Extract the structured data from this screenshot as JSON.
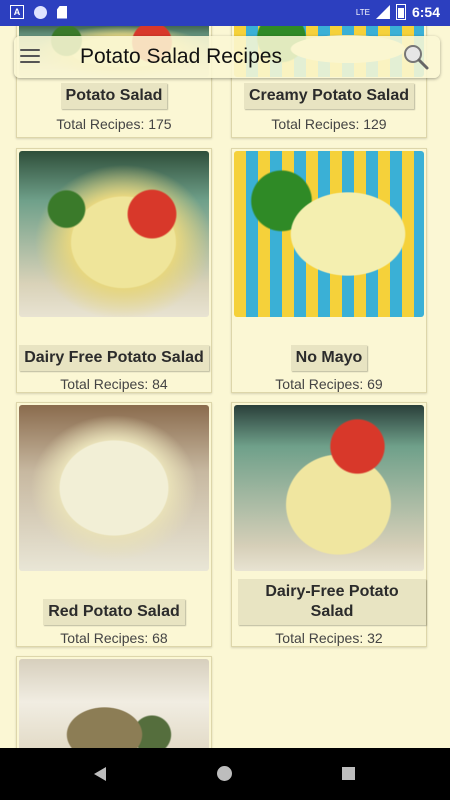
{
  "status_bar": {
    "time": "6:54",
    "network": "LTE"
  },
  "app_bar": {
    "title": "Potato Salad Recipes",
    "menu_icon": "hamburger-menu-icon",
    "search_icon": "search-icon"
  },
  "cards": [
    {
      "title": "Potato Salad",
      "count": "Total Recipes: 175"
    },
    {
      "title": "Creamy Potato Salad",
      "count": "Total Recipes: 129"
    },
    {
      "title": "Dairy Free Potato Salad",
      "count": "Total Recipes: 84"
    },
    {
      "title": "No Mayo",
      "count": "Total Recipes: 69"
    },
    {
      "title": "Red Potato Salad",
      "count": "Total Recipes: 68"
    },
    {
      "title": "Dairy-Free Potato Salad",
      "count": "Total Recipes: 32"
    }
  ],
  "nav_bar": {
    "back_icon": "back-triangle-icon",
    "home_icon": "home-circle-icon",
    "recents_icon": "recents-square-icon"
  }
}
